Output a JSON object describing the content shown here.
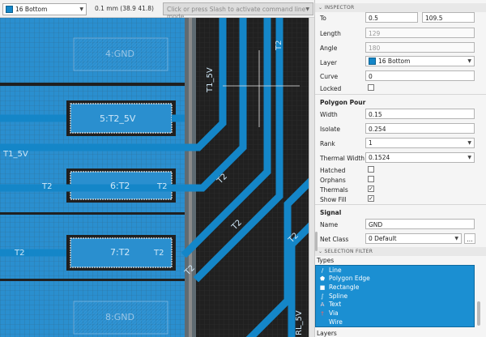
{
  "toolbar": {
    "layer": "16 Bottom",
    "coord": "0.1 mm (38.9 41.8)",
    "cmd_placeholder": "Click or press Slash to activate command line mode"
  },
  "canvas": {
    "labels": [
      "4:GND",
      "5:T2_5V",
      "6:T2",
      "7:T2",
      "8:GND",
      "T1_5V",
      "T2",
      "T1_5V",
      "T2",
      "T2",
      "T2",
      "T2",
      "T2",
      "T2",
      "T2",
      "T2",
      "RL_5V"
    ]
  },
  "inspector": {
    "header": "INSPECTOR",
    "to_label": "To",
    "to_x": "0.5",
    "to_y": "109.5",
    "length_label": "Length",
    "length_value": "129",
    "angle_label": "Angle",
    "angle_value": "180",
    "layer_label": "Layer",
    "layer_value": "16 Bottom",
    "curve_label": "Curve",
    "curve_value": "0",
    "locked_label": "Locked",
    "polygon_section": "Polygon Pour",
    "width_label": "Width",
    "width_value": "0.15",
    "isolate_label": "Isolate",
    "isolate_value": "0.254",
    "rank_label": "Rank",
    "rank_value": "1",
    "thermal_width_label": "Thermal Width",
    "thermal_width_value": "0.1524",
    "hatched_label": "Hatched",
    "orphans_label": "Orphans",
    "thermals_label": "Thermals",
    "thermals_checked": "✓",
    "showfill_label": "Show Fill",
    "showfill_checked": "✓",
    "signal_section": "Signal",
    "name_label": "Name",
    "name_value": "GND",
    "netclass_label": "Net Class",
    "netclass_value": "0 Default",
    "netclass_more": "...",
    "selection_header": "SELECTION FILTER",
    "types_label": "Types",
    "types": [
      {
        "icon": "line-icon",
        "glyph": "/",
        "label": "Line"
      },
      {
        "icon": "polygon-edge-icon",
        "glyph": "⬟",
        "label": "Polygon Edge"
      },
      {
        "icon": "rectangle-icon",
        "glyph": "■",
        "label": "Rectangle"
      },
      {
        "icon": "spline-icon",
        "glyph": "∫",
        "label": "Spline"
      },
      {
        "icon": "text-icon",
        "glyph": "A",
        "label": "Text"
      },
      {
        "icon": "via-icon",
        "glyph": "†",
        "label": "Via"
      },
      {
        "icon": "wire-icon",
        "glyph": "",
        "label": "Wire"
      }
    ],
    "layers_label": "Layers"
  },
  "colors": {
    "copper": "#1486c8",
    "pour": "#2a8fcf",
    "board": "#202020",
    "selection": "#1b8fd2"
  }
}
